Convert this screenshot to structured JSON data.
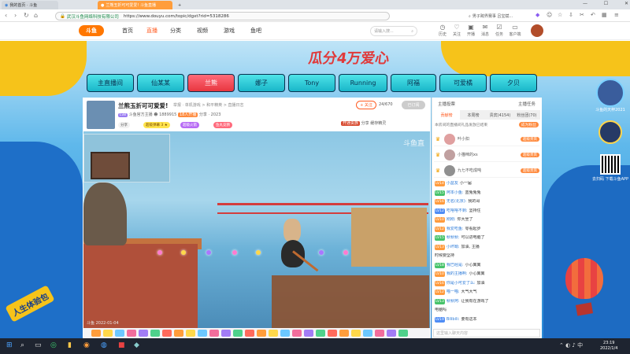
{
  "browser": {
    "tabs": [
      {
        "title": "我的首页 · 斗鱼",
        "active": false
      },
      {
        "title": "兰熊玉折可可爱爱! 斗鱼直播",
        "active": true
      }
    ],
    "add_tab": "+",
    "site_name": "斗鱼",
    "cert": "武汉斗鱼网络科技有限公司",
    "url": "https://www.douyu.com/topic/dgxt?rid=5318286",
    "search_placeholder": "男子跨界赛事 吕宝斌...",
    "window_controls": [
      "—",
      "☐",
      "✕"
    ]
  },
  "site_header": {
    "logo": "斗鱼",
    "nav": [
      {
        "label": "首页",
        "active": false
      },
      {
        "label": "直播",
        "active": true
      },
      {
        "label": "分类",
        "active": false
      },
      {
        "label": "视频",
        "active": false
      },
      {
        "label": "游戏",
        "active": false
      },
      {
        "label": "鱼吧",
        "active": false
      }
    ],
    "search_placeholder": "请输入搜...",
    "icons": [
      {
        "name": "history-icon",
        "label": "历史"
      },
      {
        "name": "follow-icon",
        "label": "关注"
      },
      {
        "name": "message-icon",
        "label": "开播"
      },
      {
        "name": "fans-icon",
        "label": "消息"
      },
      {
        "name": "task-icon",
        "label": "任务"
      },
      {
        "name": "app-icon",
        "label": "客户端"
      }
    ]
  },
  "banner": {
    "headline": "瓜分4万爱心",
    "side_text": "人生体验包"
  },
  "banner_tabs": [
    {
      "label": "主直播间",
      "active": false
    },
    {
      "label": "仙某某",
      "active": false
    },
    {
      "label": "兰熊",
      "active": true
    },
    {
      "label": "娜子",
      "active": false
    },
    {
      "label": "Tony",
      "active": false
    },
    {
      "label": "Running",
      "active": false
    },
    {
      "label": "阿福",
      "active": false
    },
    {
      "label": "可爱橘",
      "active": false
    },
    {
      "label": "夕贝",
      "active": false
    }
  ],
  "room": {
    "title": "兰熊玉折可可爱爱!",
    "meta": "举报 · 单机游戏 > 和平精英 > 直播日志",
    "follow_label": "+ 关注",
    "follow_count": "24/670",
    "subscribe_label": "已订阅",
    "level": "Lv8",
    "streamer": "斗鱼官方主播",
    "fans": "1889915",
    "rank_badge": "18人开播",
    "share_text": "分享 · 2023",
    "pills": [
      {
        "label": "分享",
        "color": "#f2f2f2",
        "text_color": "#555"
      },
      {
        "label": "超级弹幕 3 ★",
        "color": "#ffe44d",
        "text_color": "#7a4a00"
      },
      {
        "label": "超级火箭",
        "color": "#b86cf5",
        "text_color": "#fff"
      },
      {
        "label": "鱼丸竞猜",
        "color": "#ff6a7c",
        "text_color": "#fff"
      },
      {
        "label": "6488贵宾",
        "color": "#ffe14a",
        "text_color": "#7a4a00"
      }
    ],
    "right_tools": [
      "开通贵族",
      "分享",
      "缓存精灵"
    ],
    "watermark": "斗鱼直",
    "video_footer": "斗鱼 2022-01-04",
    "gift_count": 27
  },
  "chat": {
    "top_tabs": [
      "主播投票",
      "主播任务"
    ],
    "tabs": [
      {
        "label": "贡献榜",
        "active": true
      },
      {
        "label": "本周榜",
        "active": false
      },
      {
        "label": "贵宾(4154)",
        "active": false
      },
      {
        "label": "粉丝团(70)",
        "active": false
      }
    ],
    "notice": "本房间的直播间礼品发放已结束",
    "notice_button": "成为粉丝",
    "ranking": [
      {
        "name": "叶小扣",
        "tag": "超级贵宾",
        "color": "#e0a0a0"
      },
      {
        "name": "小猫咪的xs",
        "tag": "超级贵宾",
        "color": "#c0a0a0"
      },
      {
        "name": "九七不吃成吨",
        "tag": "超级贵宾",
        "color": "#909090"
      }
    ],
    "messages": [
      {
        "badge": "LV14",
        "badge_color": "",
        "user": "小盆友",
        "text": "小一届"
      },
      {
        "badge": "LV15",
        "badge_color": "g",
        "user": "阿本小鱼:",
        "text": "蓝兔兔兔"
      },
      {
        "badge": "LV16",
        "badge_color": "",
        "user": "无名(北京):",
        "text": "我的哥"
      },
      {
        "badge": "LV12",
        "badge_color": "b",
        "user": "吃啥啥不剩:",
        "text": "坚持住"
      },
      {
        "badge": "LV10",
        "badge_color": "",
        "user": "刚刚:",
        "text": "你大坐了"
      },
      {
        "badge": "LV12",
        "badge_color": "",
        "user": "我爱吃鱼:",
        "text": "零看起步"
      },
      {
        "badge": "LV15",
        "badge_color": "g",
        "user": "秋秋秋:",
        "text": "可以进电脑了"
      },
      {
        "badge": "LV13",
        "badge_color": "",
        "user": "小坏呦:",
        "text": "加油, 主播"
      },
      {
        "badge": "",
        "badge_color": "",
        "user": "",
        "text": "时候要坚持"
      },
      {
        "badge": "LV18",
        "badge_color": "g",
        "user": "我已经是:",
        "text": "小心翼翼"
      },
      {
        "badge": "LV10",
        "badge_color": "",
        "user": "我的主播啊:",
        "text": "小心翼翼"
      },
      {
        "badge": "LV16",
        "badge_color": "",
        "user": "你是小可爱了么:",
        "text": "加油"
      },
      {
        "badge": "LV12",
        "badge_color": "",
        "user": "喵一喵:",
        "text": "大气大气"
      },
      {
        "badge": "LV13",
        "badge_color": "g",
        "user": "秋秋阿:",
        "text": "让我有在游戏了"
      },
      {
        "badge": "",
        "badge_color": "",
        "user": "",
        "text": "电脑吗"
      },
      {
        "badge": "LV19",
        "badge_color": "b",
        "user": "Bilibili:",
        "text": "要有这本"
      }
    ],
    "input_placeholder": "这里输入聊天内容"
  },
  "side": {
    "label1": "斗鱼的天秤2021",
    "label2": "去扫码 下载斗鱼APP"
  },
  "taskbar": {
    "time": "23:19",
    "date": "2022/1/4"
  }
}
